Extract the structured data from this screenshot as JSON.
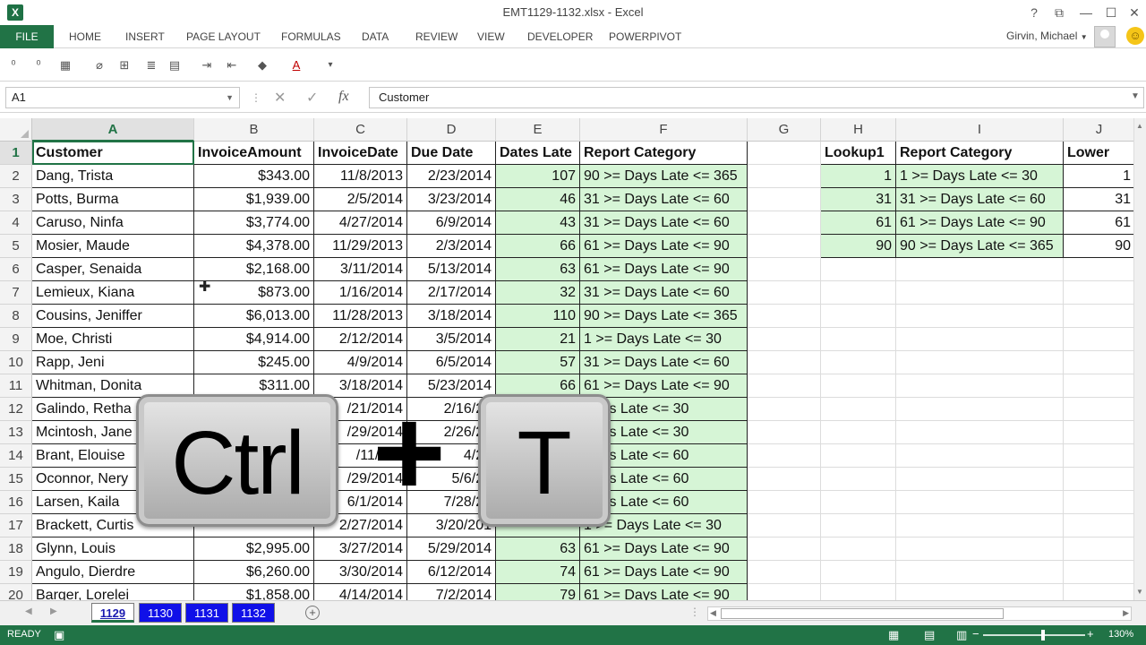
{
  "window": {
    "title": "EMT1129-1132.xlsx - Excel",
    "app_icon": "excel-icon",
    "buttons": [
      "?",
      "⧉",
      "—",
      "☐",
      "✕"
    ]
  },
  "ribbon": {
    "file": "FILE",
    "tabs": [
      "HOME",
      "INSERT",
      "PAGE LAYOUT",
      "FORMULAS",
      "DATA",
      "REVIEW",
      "VIEW",
      "DEVELOPER",
      "POWERPIVOT"
    ],
    "user": "Girvin, Michael"
  },
  "formula_bar": {
    "name_box": "A1",
    "value": "Customer"
  },
  "columns": [
    "A",
    "B",
    "C",
    "D",
    "E",
    "F",
    "G",
    "H",
    "I",
    "J"
  ],
  "rows": [
    "1",
    "2",
    "3",
    "4",
    "5",
    "6",
    "7",
    "8",
    "9",
    "10",
    "11",
    "12",
    "13",
    "14",
    "15",
    "16",
    "17",
    "18",
    "19",
    "20"
  ],
  "table1": {
    "headers": [
      "Customer",
      "InvoiceAmount",
      "InvoiceDate",
      "Due Date",
      "Dates Late",
      "Report Category"
    ],
    "rows": [
      [
        "Dang, Trista",
        "$343.00",
        "11/8/2013",
        "2/23/2014",
        "107",
        "90 >= Days Late <= 365"
      ],
      [
        "Potts, Burma",
        "$1,939.00",
        "2/5/2014",
        "3/23/2014",
        "46",
        "31 >= Days Late <= 60"
      ],
      [
        "Caruso, Ninfa",
        "$3,774.00",
        "4/27/2014",
        "6/9/2014",
        "43",
        "31 >= Days Late <= 60"
      ],
      [
        "Mosier, Maude",
        "$4,378.00",
        "11/29/2013",
        "2/3/2014",
        "66",
        "61 >= Days Late <= 90"
      ],
      [
        "Casper, Senaida",
        "$2,168.00",
        "3/11/2014",
        "5/13/2014",
        "63",
        "61 >= Days Late <= 90"
      ],
      [
        "Lemieux, Kiana",
        "$873.00",
        "1/16/2014",
        "2/17/2014",
        "32",
        "31 >= Days Late <= 60"
      ],
      [
        "Cousins, Jeniffer",
        "$6,013.00",
        "11/28/2013",
        "3/18/2014",
        "110",
        "90 >= Days Late <= 365"
      ],
      [
        "Moe, Christi",
        "$4,914.00",
        "2/12/2014",
        "3/5/2014",
        "21",
        "1 >= Days Late <= 30"
      ],
      [
        "Rapp, Jeni",
        "$245.00",
        "4/9/2014",
        "6/5/2014",
        "57",
        "31 >= Days Late <= 60"
      ],
      [
        "Whitman, Donita",
        "$311.00",
        "3/18/2014",
        "5/23/2014",
        "66",
        "61 >= Days Late <= 90"
      ],
      [
        "Galindo, Retha",
        "",
        "/21/2014",
        "2/16/20",
        "",
        "Days Late <= 30"
      ],
      [
        "Mcintosh, Jane",
        "",
        "/29/2014",
        "2/26/20",
        "",
        "Days Late <= 30"
      ],
      [
        "Brant, Elouise",
        "",
        "/11/201",
        "4/20",
        "",
        "Days Late <= 60"
      ],
      [
        "Oconnor, Nery",
        "",
        "/29/2014",
        "5/6/20",
        "",
        "Days Late <= 60"
      ],
      [
        "Larsen, Kaila",
        "",
        "6/1/2014",
        "7/28/20",
        "",
        "Days Late <= 60"
      ],
      [
        "Brackett, Curtis",
        "",
        "2/27/2014",
        "3/20/201",
        "",
        "1 >= Days Late <= 30"
      ],
      [
        "Glynn, Louis",
        "$2,995.00",
        "3/27/2014",
        "5/29/2014",
        "63",
        "61 >= Days Late <= 90"
      ],
      [
        "Angulo, Dierdre",
        "$6,260.00",
        "3/30/2014",
        "6/12/2014",
        "74",
        "61 >= Days Late <= 90"
      ],
      [
        "Barger, Lorelei",
        "$1,858.00",
        "4/14/2014",
        "7/2/2014",
        "79",
        "61 >= Days Late <= 90"
      ]
    ]
  },
  "table2": {
    "headers": [
      "Lookup1",
      "Report Category",
      "Lower"
    ],
    "rows": [
      [
        "1",
        "1 >= Days Late <= 30",
        "1"
      ],
      [
        "31",
        "31 >= Days Late <= 60",
        "31"
      ],
      [
        "61",
        "61 >= Days Late <= 90",
        "61"
      ],
      [
        "90",
        "90 >= Days Late <= 365",
        "90"
      ]
    ]
  },
  "sheets": [
    "1129",
    "1130",
    "1131",
    "1132"
  ],
  "active_sheet": "1129",
  "status": {
    "text": "READY",
    "zoom": "130%"
  },
  "overlay": {
    "key1": "Ctrl",
    "plus": "+",
    "key2": "T"
  },
  "colors": {
    "accent": "#217346",
    "green_fill": "#d6f5d6",
    "sheet_tab": "#1010e8"
  }
}
